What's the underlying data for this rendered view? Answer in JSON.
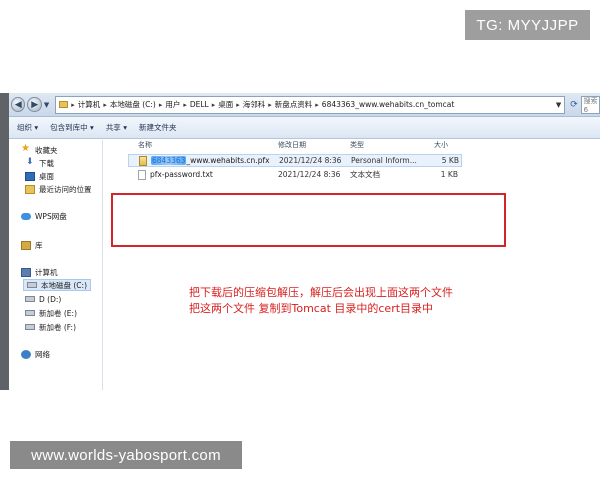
{
  "badge": {
    "text": "TG: MYYJJPP"
  },
  "watermark": {
    "text": "www.worlds-yabosport.com"
  },
  "address": {
    "crumbs": [
      "计算机",
      "本地磁盘 (C:)",
      "用户",
      "DELL",
      "桌面",
      "海邻科",
      "新盘点资料",
      "6843363_www.wehabits.cn_tomcat"
    ],
    "search_placeholder": "搜索 6"
  },
  "toolbar": {
    "organize": "组织 ▾",
    "include_library": "包含到库中 ▾",
    "share": "共享 ▾",
    "new_folder": "新建文件夹"
  },
  "sidebar": {
    "favorites": "收藏夹",
    "downloads": "下载",
    "desktop": "桌面",
    "recent": "最近访问的位置",
    "wps": "WPS网盘",
    "library": "库",
    "computer": "计算机",
    "drive_c": "本地磁盘 (C:)",
    "drive_d": "D (D:)",
    "drive_e": "新加卷 (E:)",
    "drive_f": "新加卷 (F:)",
    "network": "网络"
  },
  "columns": {
    "name": "名称",
    "date": "修改日期",
    "type": "类型",
    "size": "大小"
  },
  "files": [
    {
      "name_redacted": "6843363",
      "name_rest": "_www.wehabits.cn.pfx",
      "date": "2021/12/24 8:36",
      "type": "Personal Inform...",
      "size": "5 KB"
    },
    {
      "name": "pfx-password.txt",
      "date": "2021/12/24 8:36",
      "type": "文本文档",
      "size": "1 KB"
    }
  ],
  "annotation": {
    "line1": "把下载后的压缩包解压，解压后会出现上面这两个文件",
    "line2": "把这两个文件 复制到Tomcat 目录中的cert目录中"
  },
  "colors": {
    "annotation": "#d81e1e",
    "highlight_box": "#d0252a",
    "badge_bg": "#9e9e9e",
    "watermark_bg": "#8a8a8a"
  }
}
